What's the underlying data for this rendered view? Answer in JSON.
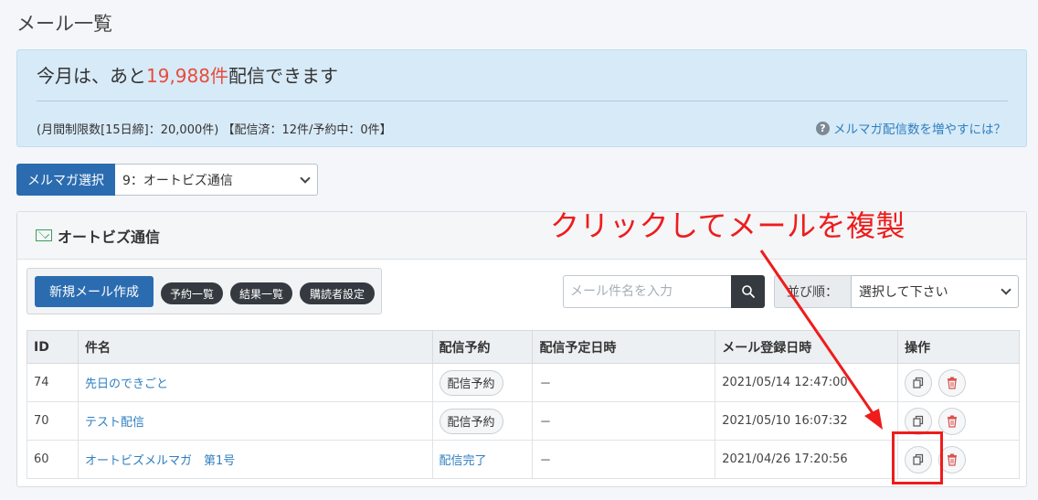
{
  "page": {
    "title": "メール一覧"
  },
  "info": {
    "headline_prefix": "今月は、あと",
    "headline_count": "19,988件",
    "headline_suffix": "配信できます",
    "detail": "(月間制限数[15日締]：20,000件) 【配信済：12件/予約中：0件】",
    "help_link": "メルマガ配信数を増やすには？"
  },
  "magazine_select": {
    "label": "メルマガ選択",
    "value": "9：オートビズ通信"
  },
  "panel": {
    "title": "オートビズ通信"
  },
  "buttons": {
    "new_mail": "新規メール作成",
    "reservations": "予約一覧",
    "results": "結果一覧",
    "subscribers": "購読者設定"
  },
  "search": {
    "placeholder": "メール件名を入力"
  },
  "sort": {
    "label": "並び順：",
    "value": "選択して下さい"
  },
  "table": {
    "headers": [
      "ID",
      "件名",
      "配信予約",
      "配信予定日時",
      "メール登録日時",
      "操作"
    ],
    "rows": [
      {
        "id": "74",
        "subject": "先日のできごと",
        "status": "配信予約",
        "scheduled": "－",
        "registered": "2021/05/14 12:47:00"
      },
      {
        "id": "70",
        "subject": "テスト配信",
        "status": "配信予約",
        "scheduled": "－",
        "registered": "2021/05/10 16:07:32"
      },
      {
        "id": "60",
        "subject": "オートビズメルマガ　第1号",
        "status": "配信完了",
        "scheduled": "－",
        "registered": "2021/04/26 17:20:56"
      }
    ]
  },
  "annotation": {
    "text": "クリックしてメールを複製"
  },
  "colors": {
    "accent_blue": "#2b6cb0",
    "link_blue": "#2f7fc1",
    "alert_red": "#ee1c1c",
    "count_red": "#e74c3c",
    "info_bg": "#d7eaf7"
  },
  "icons": {
    "help": "question-circle-icon",
    "mail": "envelope-icon",
    "search": "search-icon",
    "copy": "copy-icon",
    "delete": "trash-icon"
  }
}
